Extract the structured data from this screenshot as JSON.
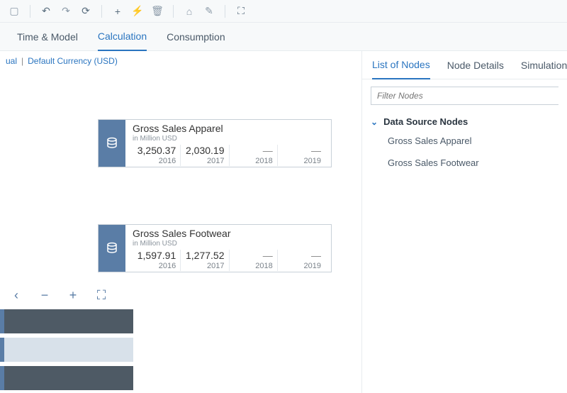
{
  "toolbar": {
    "icons": [
      "square-icon",
      "undo-icon",
      "redo-icon",
      "refresh-icon",
      "plus-icon",
      "bolt-icon",
      "trash-icon",
      "home-icon",
      "pencil-icon",
      "expand-icon"
    ]
  },
  "main_tabs": {
    "items": [
      {
        "label": "Time & Model",
        "selected": false
      },
      {
        "label": "Calculation",
        "selected": true
      },
      {
        "label": "Consumption",
        "selected": false
      }
    ]
  },
  "subheader": {
    "left": "ual",
    "right": "Default Currency (USD)"
  },
  "nodes": [
    {
      "title": "Gross Sales Apparel",
      "subtitle": "in Million USD",
      "cells": [
        {
          "value": "3,250.37",
          "year": "2016"
        },
        {
          "value": "2,030.19",
          "year": "2017"
        },
        {
          "value": "—",
          "year": "2018"
        },
        {
          "value": "—",
          "year": "2019"
        }
      ]
    },
    {
      "title": "Gross Sales Footwear",
      "subtitle": "in Million USD",
      "cells": [
        {
          "value": "1,597.91",
          "year": "2016"
        },
        {
          "value": "1,277.52",
          "year": "2017"
        },
        {
          "value": "—",
          "year": "2018"
        },
        {
          "value": "—",
          "year": "2019"
        }
      ]
    }
  ],
  "minimap_controls": {
    "back": "‹",
    "zoom_out": "−",
    "zoom_in": "+",
    "expand": "⛶"
  },
  "right_panel": {
    "tabs": [
      {
        "label": "List of Nodes",
        "selected": true
      },
      {
        "label": "Node Details",
        "selected": false
      },
      {
        "label": "Simulation",
        "selected": false
      }
    ],
    "filter_placeholder": "Filter Nodes",
    "group": {
      "title": "Data Source Nodes",
      "items": [
        "Gross Sales Apparel",
        "Gross Sales Footwear"
      ]
    }
  }
}
